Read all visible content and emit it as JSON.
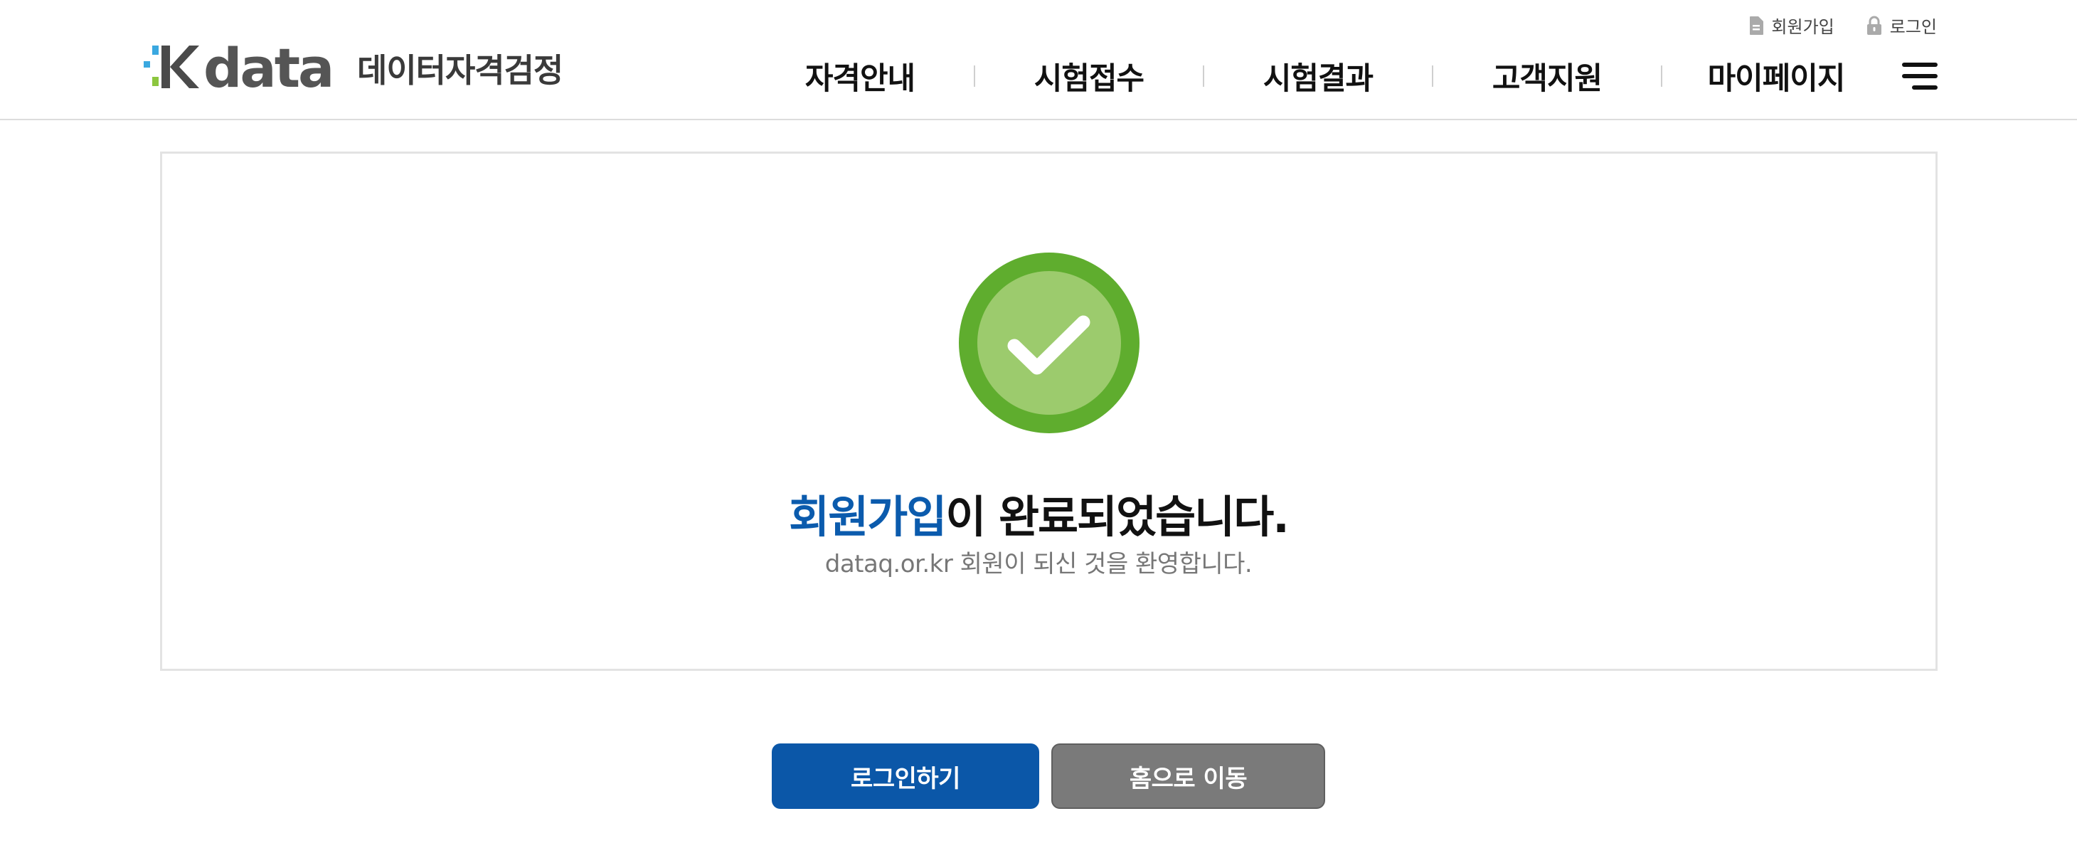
{
  "header": {
    "logo": {
      "brand": "data",
      "subtitle": "데이터자격검정"
    },
    "util": [
      {
        "label": "회원가입",
        "icon": "document-icon"
      },
      {
        "label": "로그인",
        "icon": "lock-icon"
      }
    ],
    "nav": [
      {
        "label": "자격안내"
      },
      {
        "label": "시험접수"
      },
      {
        "label": "시험결과"
      },
      {
        "label": "고객지원"
      },
      {
        "label": "마이페이지"
      }
    ],
    "menu_icon": "hamburger-menu-icon"
  },
  "main": {
    "success_icon": "check-circle-icon",
    "title_highlight": "회원가입",
    "title_rest": "이 완료되었습니다.",
    "subtitle": "dataq.or.kr 회원이 되신 것을 환영합니다."
  },
  "actions": {
    "login_label": "로그인하기",
    "home_label": "홈으로 이동"
  },
  "colors": {
    "accent_blue": "#0b57a8",
    "success_green": "#5fad2e",
    "success_green_light": "#9ccb6d",
    "secondary_gray": "#7a7a7a"
  }
}
